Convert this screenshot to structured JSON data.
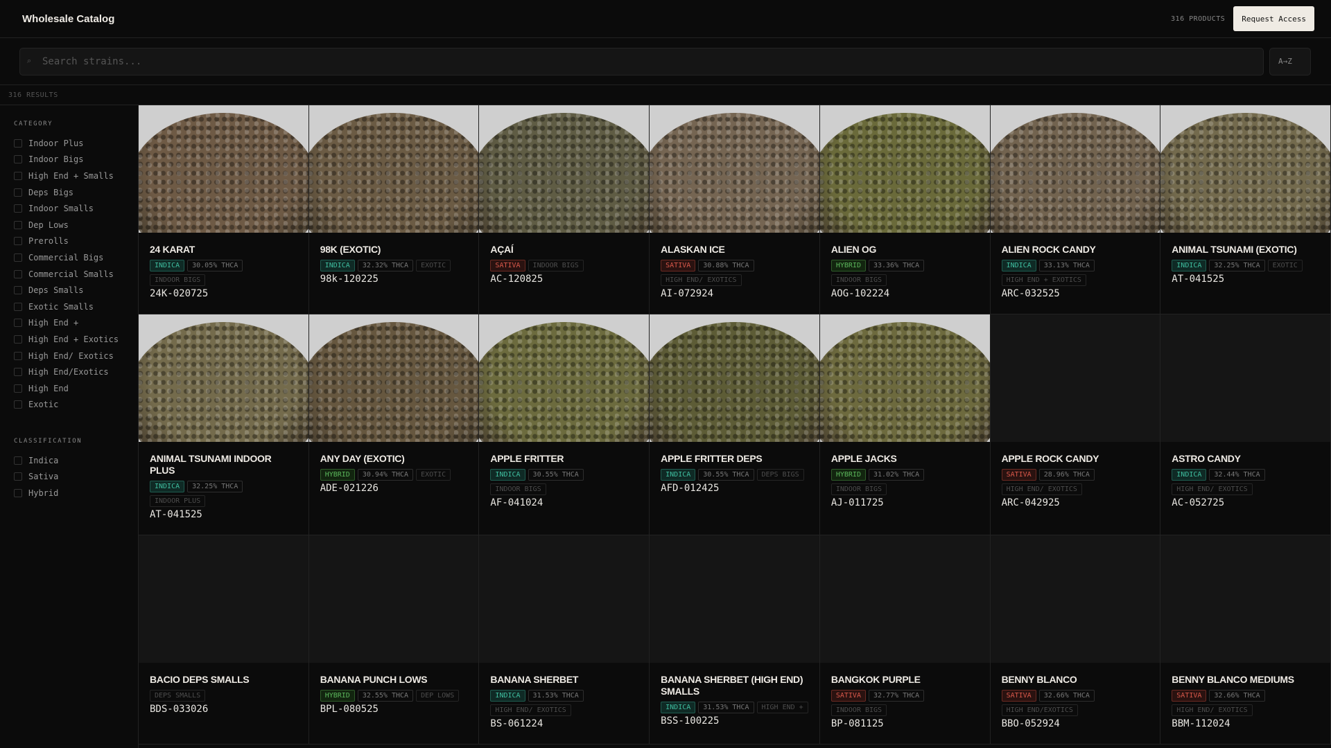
{
  "header": {
    "title": "Wholesale Catalog",
    "product_count": "316 PRODUCTS",
    "request_access": "Request Access"
  },
  "search": {
    "placeholder": "Search strains...",
    "icon": "search-icon",
    "sort_label": "A→Z"
  },
  "results_count": "316 RESULTS",
  "sidebar": {
    "category_heading": "CATEGORY",
    "categories": [
      "Indoor Plus",
      "Indoor Bigs",
      "High End + Smalls",
      "Deps Bigs",
      "Indoor Smalls",
      "Dep Lows",
      "Prerolls",
      "Commercial Bigs",
      "Commercial Smalls",
      "Deps Smalls",
      "Exotic Smalls",
      "High End +",
      "High End + Exotics",
      "High End/ Exotics",
      "High End/Exotics",
      "High End",
      "Exotic"
    ],
    "classification_heading": "CLASSIFICATION",
    "classifications": [
      "Indica",
      "Sativa",
      "Hybrid"
    ]
  },
  "colors": {
    "indica": "#3fbfa0",
    "sativa": "#d9584a",
    "hybrid": "#5cb85c",
    "background": "#0b0b0b"
  },
  "products": [
    {
      "name": "24 KARAT",
      "type": "INDICA",
      "thca": "30.05% THCA",
      "category": "INDOOR BIGS",
      "code": "24K-020725",
      "image": true,
      "tone": "#6e5a45"
    },
    {
      "name": "98K (EXOTIC)",
      "type": "INDICA",
      "thca": "32.32% THCA",
      "category": "EXOTIC",
      "code": "98k-120225",
      "image": true,
      "tone": "#6b5b44"
    },
    {
      "name": "AÇAÍ",
      "type": "SATIVA",
      "thca": null,
      "category": "INDOOR BIGS",
      "code": "AC-120825",
      "image": true,
      "tone": "#5f5c44"
    },
    {
      "name": "ALASKAN ICE",
      "type": "SATIVA",
      "thca": "30.88% THCA",
      "category": "HIGH END/ EXOTICS",
      "code": "AI-072924",
      "image": true,
      "tone": "#756552"
    },
    {
      "name": "ALIEN OG",
      "type": "HYBRID",
      "thca": "33.36% THCA",
      "category": "INDOOR BIGS",
      "code": "AOG-102224",
      "image": true,
      "tone": "#6a6a3a"
    },
    {
      "name": "ALIEN ROCK CANDY",
      "type": "INDICA",
      "thca": "33.13% THCA",
      "category": "HIGH END + EXOTICS",
      "code": "ARC-032525",
      "image": true,
      "tone": "#72634f"
    },
    {
      "name": "ANIMAL TSUNAMI (EXOTIC)",
      "type": "INDICA",
      "thca": "32.25% THCA",
      "category": "EXOTIC",
      "code": "AT-041525",
      "image": true,
      "tone": "#736a4d"
    },
    {
      "name": "ANIMAL TSUNAMI INDOOR PLUS",
      "type": "INDICA",
      "thca": "32.25% THCA",
      "category": "INDOOR PLUS",
      "code": "AT-041525",
      "image": true,
      "tone": "#746b4c"
    },
    {
      "name": "ANY DAY (EXOTIC)",
      "type": "HYBRID",
      "thca": "30.94% THCA",
      "category": "EXOTIC",
      "code": "ADE-021226",
      "image": true,
      "tone": "#66573f"
    },
    {
      "name": "APPLE FRITTER",
      "type": "INDICA",
      "thca": "30.55% THCA",
      "category": "INDOOR BIGS",
      "code": "AF-041024",
      "image": true,
      "tone": "#6c6b3e"
    },
    {
      "name": "APPLE FRITTER DEPS",
      "type": "INDICA",
      "thca": "30.55% THCA",
      "category": "DEPS BIGS",
      "code": "AFD-012425",
      "image": true,
      "tone": "#5d5c36"
    },
    {
      "name": "APPLE JACKS",
      "type": "HYBRID",
      "thca": "31.02% THCA",
      "category": "INDOOR BIGS",
      "code": "AJ-011725",
      "image": true,
      "tone": "#6d6a3e"
    },
    {
      "name": "APPLE ROCK CANDY",
      "type": "SATIVA",
      "thca": "28.96% THCA",
      "category": "HIGH END/ EXOTICS",
      "code": "ARC-042925",
      "image": false
    },
    {
      "name": "ASTRO CANDY",
      "type": "INDICA",
      "thca": "32.44% THCA",
      "category": "HIGH END/ EXOTICS",
      "code": "AC-052725",
      "image": false
    },
    {
      "name": "BACIO DEPS SMALLS",
      "type": null,
      "thca": null,
      "category": "DEPS SMALLS",
      "code": "BDS-033026",
      "image": false
    },
    {
      "name": "BANANA PUNCH LOWS",
      "type": "HYBRID",
      "thca": "32.55% THCA",
      "category": "DEP LOWS",
      "code": "BPL-080525",
      "image": false
    },
    {
      "name": "BANANA SHERBET",
      "type": "INDICA",
      "thca": "31.53% THCA",
      "category": "HIGH END/ EXOTICS",
      "code": "BS-061224",
      "image": false
    },
    {
      "name": "BANANA SHERBET (HIGH END) SMALLS",
      "type": "INDICA",
      "thca": "31.53% THCA",
      "category": "HIGH END +",
      "code": "BSS-100225",
      "image": false
    },
    {
      "name": "BANGKOK PURPLE",
      "type": "SATIVA",
      "thca": "32.77% THCA",
      "category": "INDOOR BIGS",
      "code": "BP-081125",
      "image": false
    },
    {
      "name": "BENNY BLANCO",
      "type": "SATIVA",
      "thca": "32.66% THCA",
      "category": "HIGH END/EXOTICS",
      "code": "BBO-052924",
      "image": false
    },
    {
      "name": "BENNY BLANCO MEDIUMS",
      "type": "SATIVA",
      "thca": "32.66% THCA",
      "category": "HIGH END/ EXOTICS",
      "code": "BBM-112024",
      "image": false
    }
  ]
}
